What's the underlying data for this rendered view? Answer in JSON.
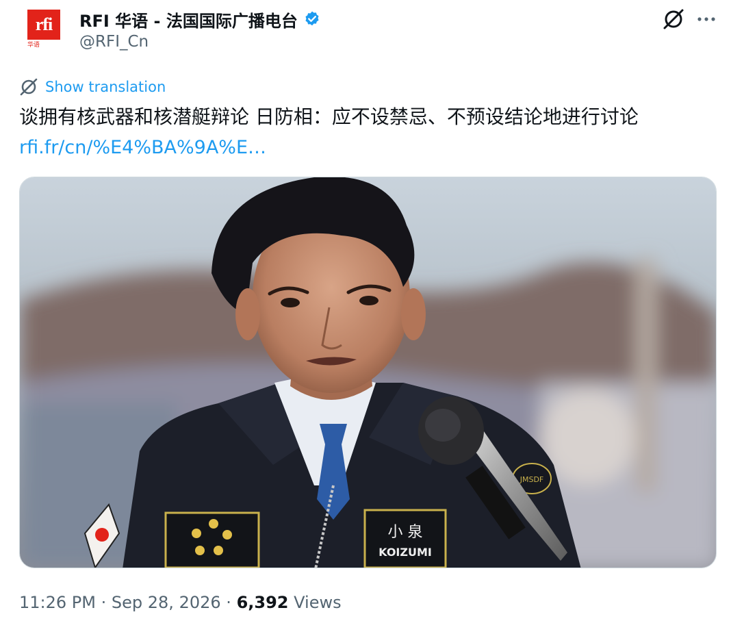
{
  "account": {
    "display_name": "RFI 华语 - 法国国际广播电台",
    "handle": "@RFI_Cn",
    "avatar_logo": "rfi",
    "avatar_sub": "华语",
    "verified_color": "#1d9bf0",
    "brand_color": "#e2231a"
  },
  "actions": {
    "grok_icon": "slash-circle-icon",
    "more_label": "···"
  },
  "translate": {
    "label": "Show translation"
  },
  "tweet": {
    "text": "谈拥有核武器和核潜艇辩论 日防相：应不设禁忌、不预设结论地进行讨论",
    "link": "rfi.fr/cn/%E4%BA%9A%E…"
  },
  "media": {
    "patch_name_cn": "小 泉",
    "patch_name_en": "KOIZUMI",
    "badge_text": "JMSDF"
  },
  "meta": {
    "time": "11:26 PM",
    "separator": "·",
    "date": "Sep 28, 2026",
    "views_count": "6,392",
    "views_label": "Views"
  }
}
